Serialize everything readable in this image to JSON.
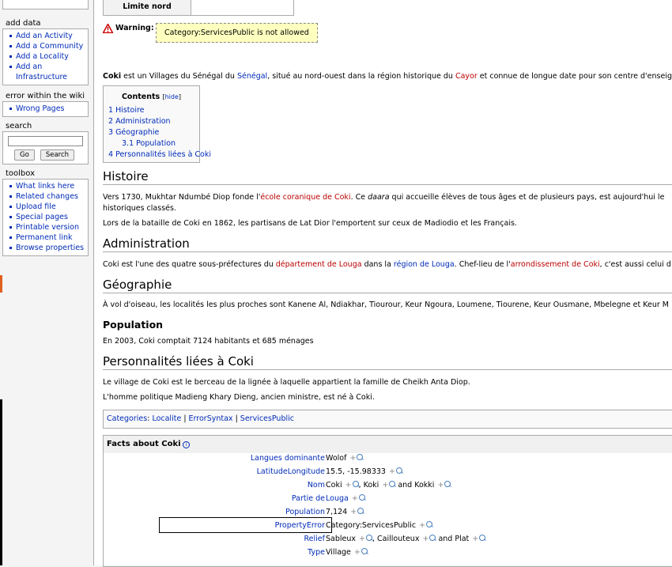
{
  "sidebar": {
    "add_data": {
      "title": "add data",
      "items": [
        "Add an Activity",
        "Add a Community",
        "Add a Locality",
        "Add an Infrastructure"
      ]
    },
    "errors": {
      "title": "error within the wiki",
      "items": [
        "Wrong Pages"
      ]
    },
    "search": {
      "title": "search",
      "go": "Go",
      "search": "Search"
    },
    "toolbox": {
      "title": "toolbox",
      "items": [
        "What links here",
        "Related changes",
        "Upload file",
        "Special pages",
        "Printable version",
        "Permanent link",
        "Browse properties"
      ]
    }
  },
  "infobox": {
    "label": "Limite nord"
  },
  "warning": {
    "label": "Warning",
    "message": "Category:ServicesPublic is not allowed"
  },
  "intro": {
    "bold": "Coki",
    "t1": " est un Villages du Sénégal du ",
    "l1": "Sénégal",
    "t2": ", situé au nord-ouest dans la région historique du ",
    "l2": "Cayor",
    "t3": " et connue de longue date pour son centre d'enseignement"
  },
  "toc": {
    "title": "Contents",
    "hide": "hide",
    "items": [
      "1 Histoire",
      "2 Administration",
      "3 Géographie",
      "3.1 Population",
      "4 Personnalités liées à Coki"
    ]
  },
  "sections": {
    "histoire": {
      "title": "Histoire",
      "p1a": "Vers 1730, Mukhtar Ndumbé Diop fonde l'",
      "p1link": "école coranique de Coki",
      "p1b": ". Ce ",
      "p1i": "daara",
      "p1c": " qui accueille élèves de tous âges et de plusieurs pays, est aujourd'hui le",
      "p1d": "historiques classés.",
      "p2": "Lors de la bataille de Coki en 1862, les partisans de Lat Dior l'emportent sur ceux de Madiodio et les Français."
    },
    "administration": {
      "title": "Administration",
      "a": "Coki est l'une des quatre sous-préfectures du ",
      "l1": "département de Louga",
      "b": " dans la ",
      "l2": "région de Louga",
      "c": ". Chef-lieu de l'",
      "l3": "arrondissement de Coki",
      "d": ", c'est aussi celui d"
    },
    "geographie": {
      "title": "Géographie",
      "text": "À vol d'oiseau, les localités les plus proches sont Kanene Al, Ndiakhar, Tiourour, Keur Ngoura, Loumene, Tiourene, Keur Ousmane, Mbelegne et Keur M"
    },
    "population": {
      "title": "Population",
      "text": "En 2003, Coki comptait 7124 habitants et 685 ménages"
    },
    "personnalites": {
      "title": "Personnalités liées à Coki",
      "p1": "Le village de Coki est le berceau de la lignée à laquelle appartient la famille de Cheikh Anta Diop.",
      "p2": "L'homme politique Madieng Khary Dieng, ancien ministre, est né à Coki."
    }
  },
  "categories": {
    "label": "Categories",
    "items": [
      "Localite",
      "ErrorSyntax",
      "ServicesPublic"
    ]
  },
  "facts": {
    "title": "Facts about Coki",
    "rows": [
      {
        "prop": "Langues dominante",
        "vals": [
          "Wolof"
        ],
        "sep": []
      },
      {
        "prop": "LatitudeLongitude",
        "vals": [
          "15.5, -15.98333"
        ],
        "sep": []
      },
      {
        "prop": "Nom",
        "vals": [
          "Coki",
          "Koki",
          "Kokki"
        ],
        "sep": [
          ", ",
          " and "
        ]
      },
      {
        "prop": "Partie de",
        "vals": [
          "Louga"
        ],
        "sep": [],
        "link": true
      },
      {
        "prop": "Population",
        "vals": [
          "7,124"
        ],
        "sep": []
      },
      {
        "prop": "PropertyError",
        "vals": [
          "Category:ServicesPublic"
        ],
        "sep": []
      },
      {
        "prop": "Relief",
        "vals": [
          "Sableux",
          "Caillouteux",
          "Plat"
        ],
        "sep": [
          ", ",
          " and "
        ]
      },
      {
        "prop": "Type",
        "vals": [
          "Village"
        ],
        "sep": []
      }
    ],
    "plus": "+"
  },
  "colors": {
    "link": "#002bb8",
    "redlink": "#ba0000",
    "warning_bg": "#ffffc0"
  }
}
